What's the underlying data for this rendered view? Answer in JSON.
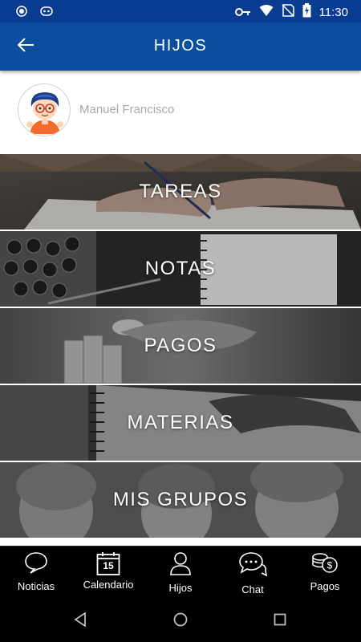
{
  "status_bar": {
    "time": "11:30",
    "icons": [
      "circle-icon",
      "voicemail-icon",
      "key-icon",
      "wifi-icon",
      "no-sim-icon",
      "battery-charging-icon"
    ]
  },
  "header": {
    "title": "HIJOS",
    "back_icon": "arrow-left-icon",
    "color": "#0b4ea0"
  },
  "profile": {
    "name": "Manuel Francisco",
    "avatar_icon": "child-avatar-icon"
  },
  "menu": {
    "items": [
      {
        "label": "TAREAS"
      },
      {
        "label": "NOTAS"
      },
      {
        "label": "PAGOS"
      },
      {
        "label": "MATERIAS"
      },
      {
        "label": "MIS GRUPOS"
      }
    ]
  },
  "bottom_nav": {
    "items": [
      {
        "label": "Noticias",
        "icon": "chat-bubble-icon"
      },
      {
        "label": "Calendario",
        "icon": "calendar-icon",
        "day": "15"
      },
      {
        "label": "Hijos",
        "icon": "person-icon"
      },
      {
        "label": "Chat",
        "icon": "chat-dots-icon"
      },
      {
        "label": "Pagos",
        "icon": "coins-icon"
      }
    ]
  },
  "system_nav": {
    "icons": [
      "back-triangle-icon",
      "home-circle-icon",
      "recents-square-icon"
    ]
  }
}
